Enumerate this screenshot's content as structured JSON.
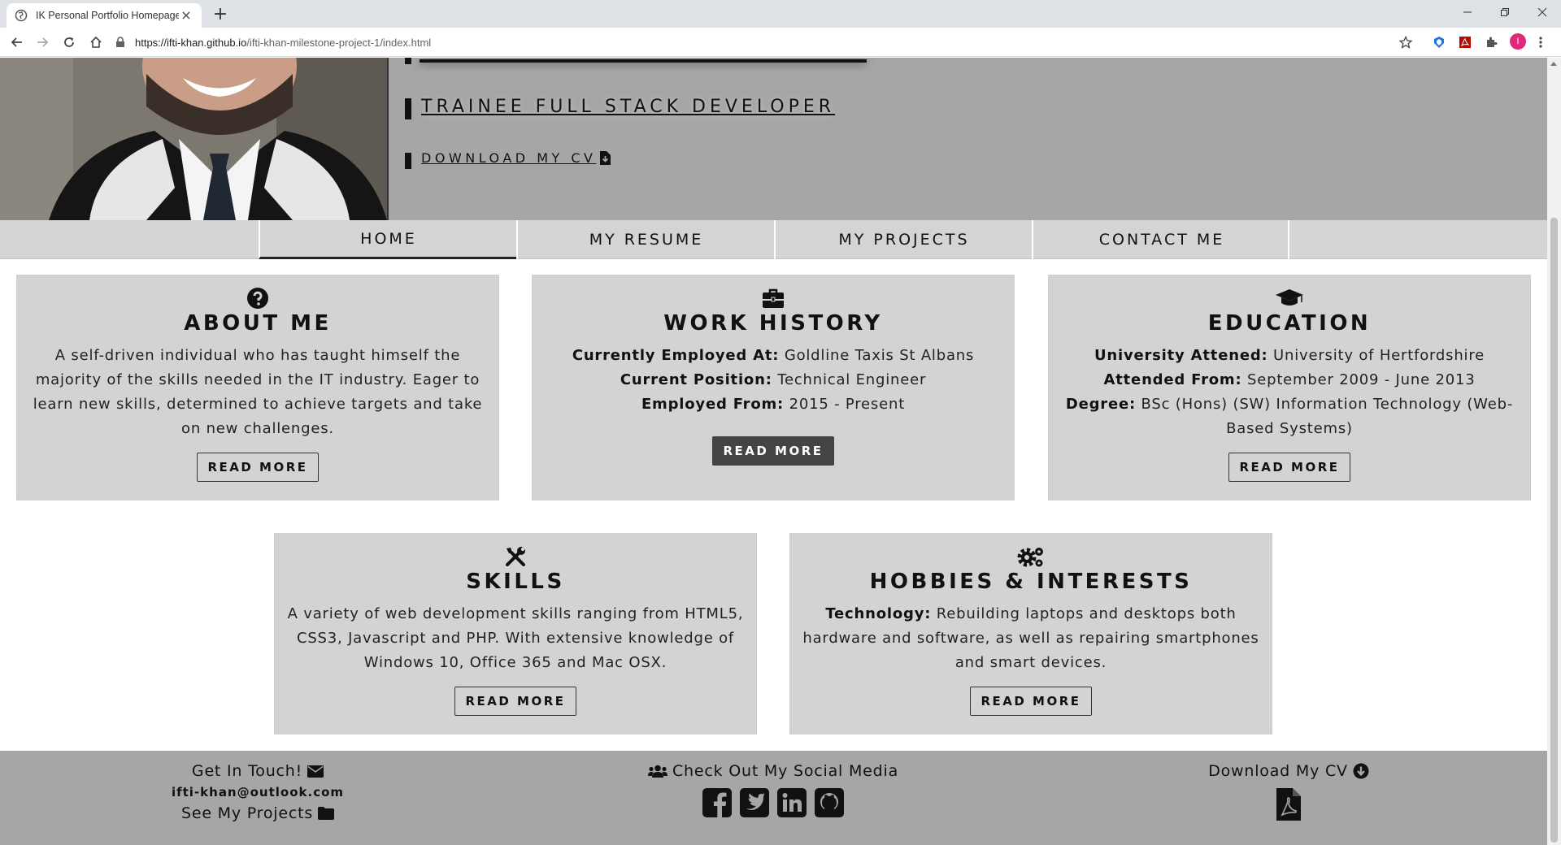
{
  "browser": {
    "tab_title": "IK Personal Portfolio Homepage",
    "url_host": "https://ifti-khan.github.io",
    "url_path": "/ifti-khan-milestone-project-1/index.html",
    "profile_initial": "I"
  },
  "hero": {
    "title": "TRAINEE FULL STACK DEVELOPER",
    "cv_link": "DOWNLOAD MY CV"
  },
  "nav": {
    "items": [
      {
        "label": "HOME"
      },
      {
        "label": "MY RESUME"
      },
      {
        "label": "MY PROJECTS"
      },
      {
        "label": "CONTACT ME"
      }
    ]
  },
  "cards": {
    "about": {
      "title": "ABOUT ME",
      "text": "A self-driven individual who has taught himself the majority of the skills needed in the IT industry. Eager to learn new skills, determined to achieve targets and take on new challenges.",
      "button": "READ MORE"
    },
    "work": {
      "title": "WORK HISTORY",
      "l1_label": "Currently Employed At:",
      "l1_value": " Goldline Taxis St Albans",
      "l2_label": "Current Position:",
      "l2_value": " Technical Engineer",
      "l3_label": "Employed From:",
      "l3_value": " 2015 - Present",
      "button": "READ MORE"
    },
    "education": {
      "title": "EDUCATION",
      "l1_label": "University Attened:",
      "l1_value": " University of Hertfordshire",
      "l2_label": "Attended From:",
      "l2_value": " September 2009 - June 2013",
      "l3_label": "Degree:",
      "l3_value": " BSc (Hons) (SW) Information Technology (Web-Based Systems)",
      "button": "READ MORE"
    },
    "skills": {
      "title": "SKILLS",
      "text": "A variety of web development skills ranging from HTML5, CSS3, Javascript and PHP. With extensive knowledge of Windows 10, Office 365 and Mac OSX.",
      "button": "READ MORE"
    },
    "hobbies": {
      "title": "HOBBIES & INTERESTS",
      "label": "Technology:",
      "value": " Rebuilding laptops and desktops both hardware and software, as well as repairing smartphones and smart devices.",
      "button": "READ MORE"
    }
  },
  "footer": {
    "touch": "Get In Touch!",
    "email": "ifti-khan@outlook.com",
    "projects": "See My Projects",
    "social": "Check Out My Social Media",
    "download": "Download My CV"
  },
  "colors": {
    "hero_bg": "#a6a6a6",
    "card_bg": "#d3d3d3",
    "nav_bg": "#d4d4d4",
    "footer_bg": "#a6a6a6",
    "dark_button": "#444444"
  }
}
